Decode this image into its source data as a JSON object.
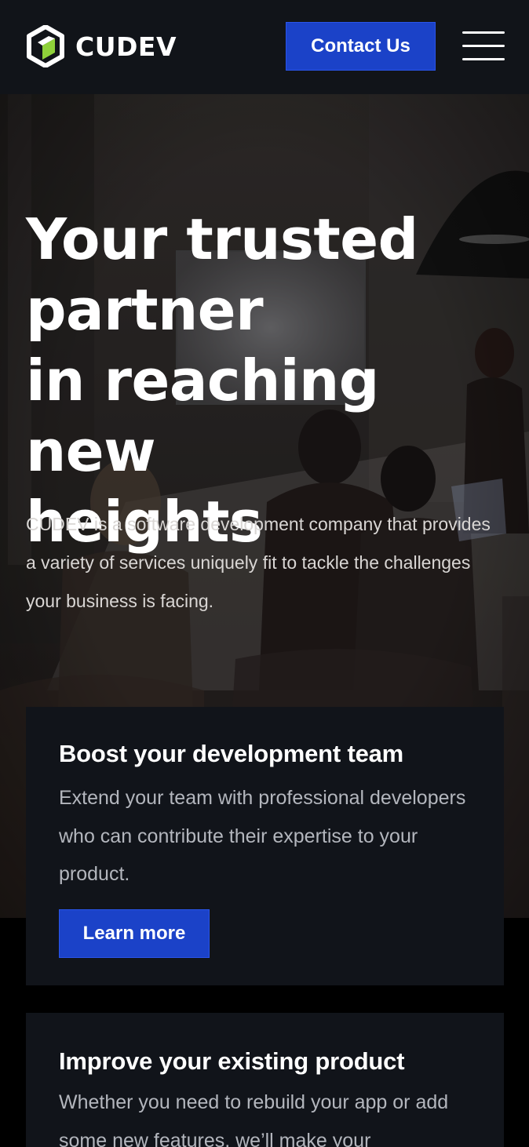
{
  "header": {
    "brand": "CUDEV",
    "contact_label": "Contact Us"
  },
  "hero": {
    "title_lines": [
      "Your trusted",
      "partner",
      "in reaching new",
      "heights"
    ],
    "description": "CUDEV is a software development company that provides a variety of services uniquely fit to tackle the challenges your business is facing."
  },
  "cards": [
    {
      "title": "Boost your development team",
      "text": "Extend your team with professional developers who can contribute their expertise to your product.",
      "button_label": "Learn more"
    },
    {
      "title": "Improve your existing product",
      "text": "Whether you need to rebuild your app or add some new features, we’ll make your"
    }
  ],
  "colors": {
    "header_bg": "#111419",
    "accent_blue": "#1b42c8",
    "logo_green": "#8fd13a",
    "card_bg": "#11141a"
  },
  "icons": [
    "cudev-logo-icon",
    "hamburger-menu-icon"
  ]
}
